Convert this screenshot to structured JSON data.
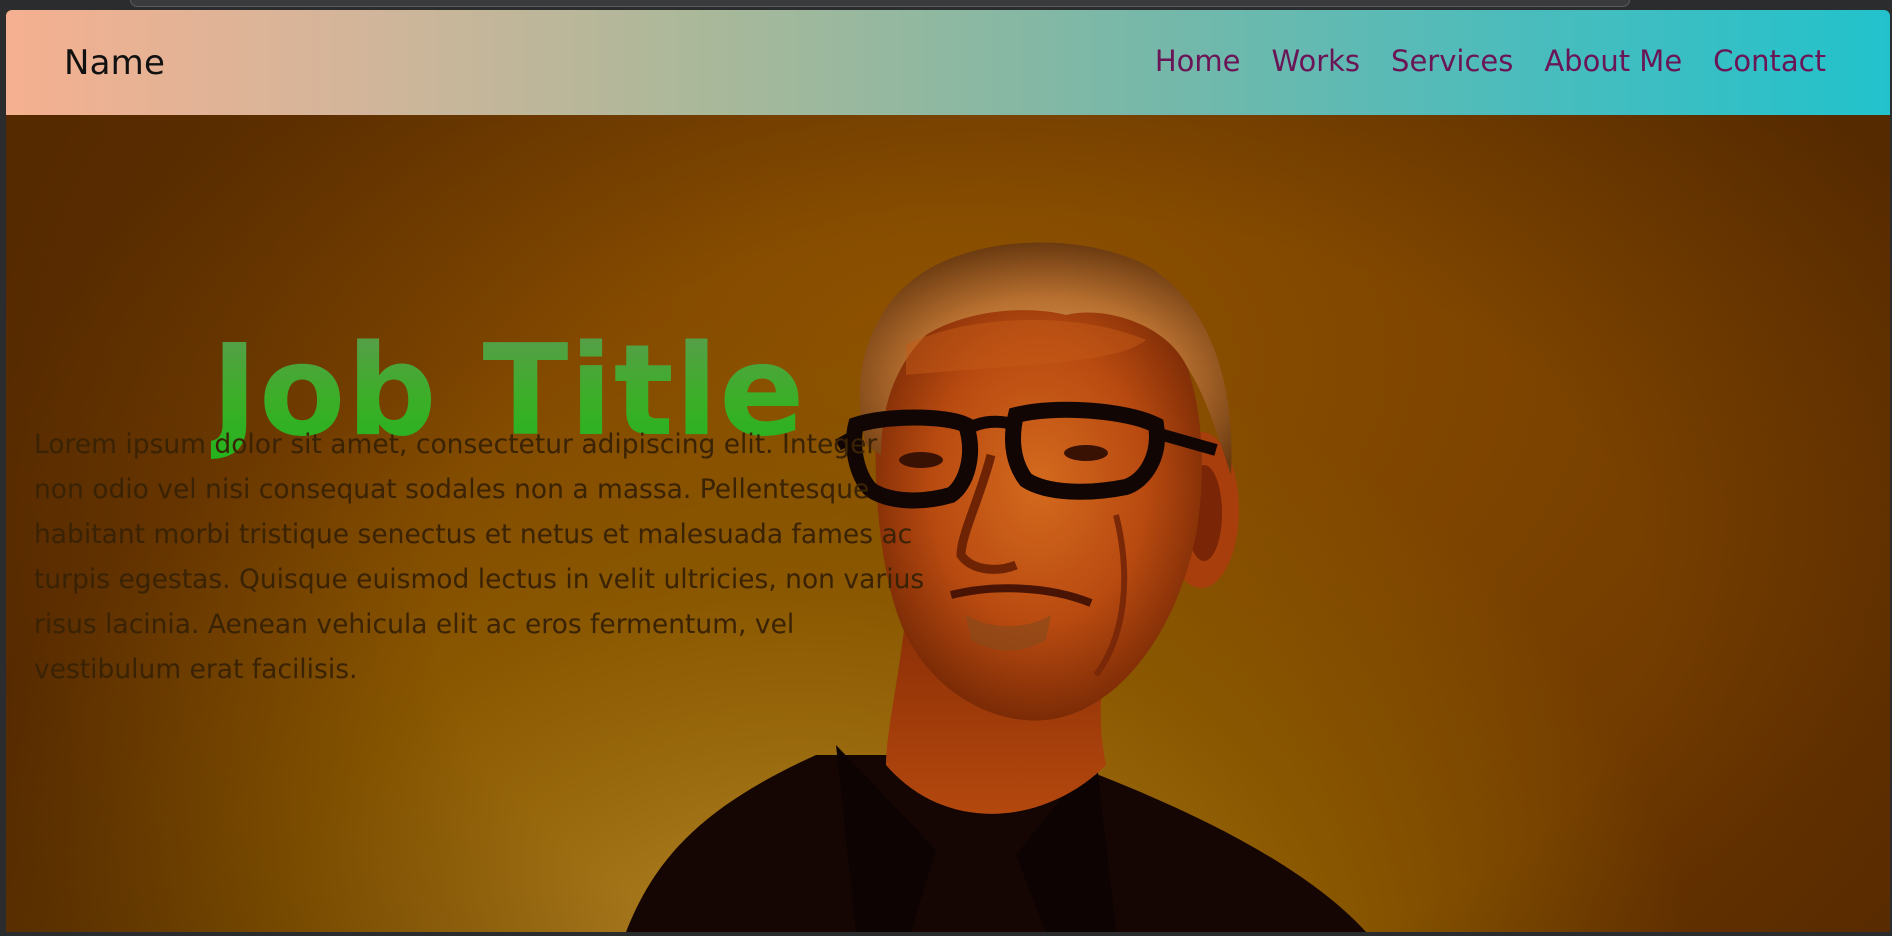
{
  "nav": {
    "brand": "Name",
    "links": [
      "Home",
      "Works",
      "Services",
      "About Me",
      "Contact"
    ]
  },
  "hero": {
    "job_title": "Job Title",
    "bio": "Lorem ipsum dolor sit amet, consectetur adipiscing elit. Integer non odio vel nisi consequat sodales non a massa. Pellentesque habitant morbi tristique senectus et netus et malesuada fames ac turpis egestas. Quisque euismod lectus in velit ultricies, non varius risus lacinia. Aenean vehicula elit ac eros fermentum, vel vestibulum erat facilisis."
  },
  "colors": {
    "nav_gradient_start": "#f5b090",
    "nav_gradient_end": "#22c2cc",
    "nav_link": "#6a1555",
    "job_title": "#3cae28",
    "hero_background": "#8a5800"
  }
}
